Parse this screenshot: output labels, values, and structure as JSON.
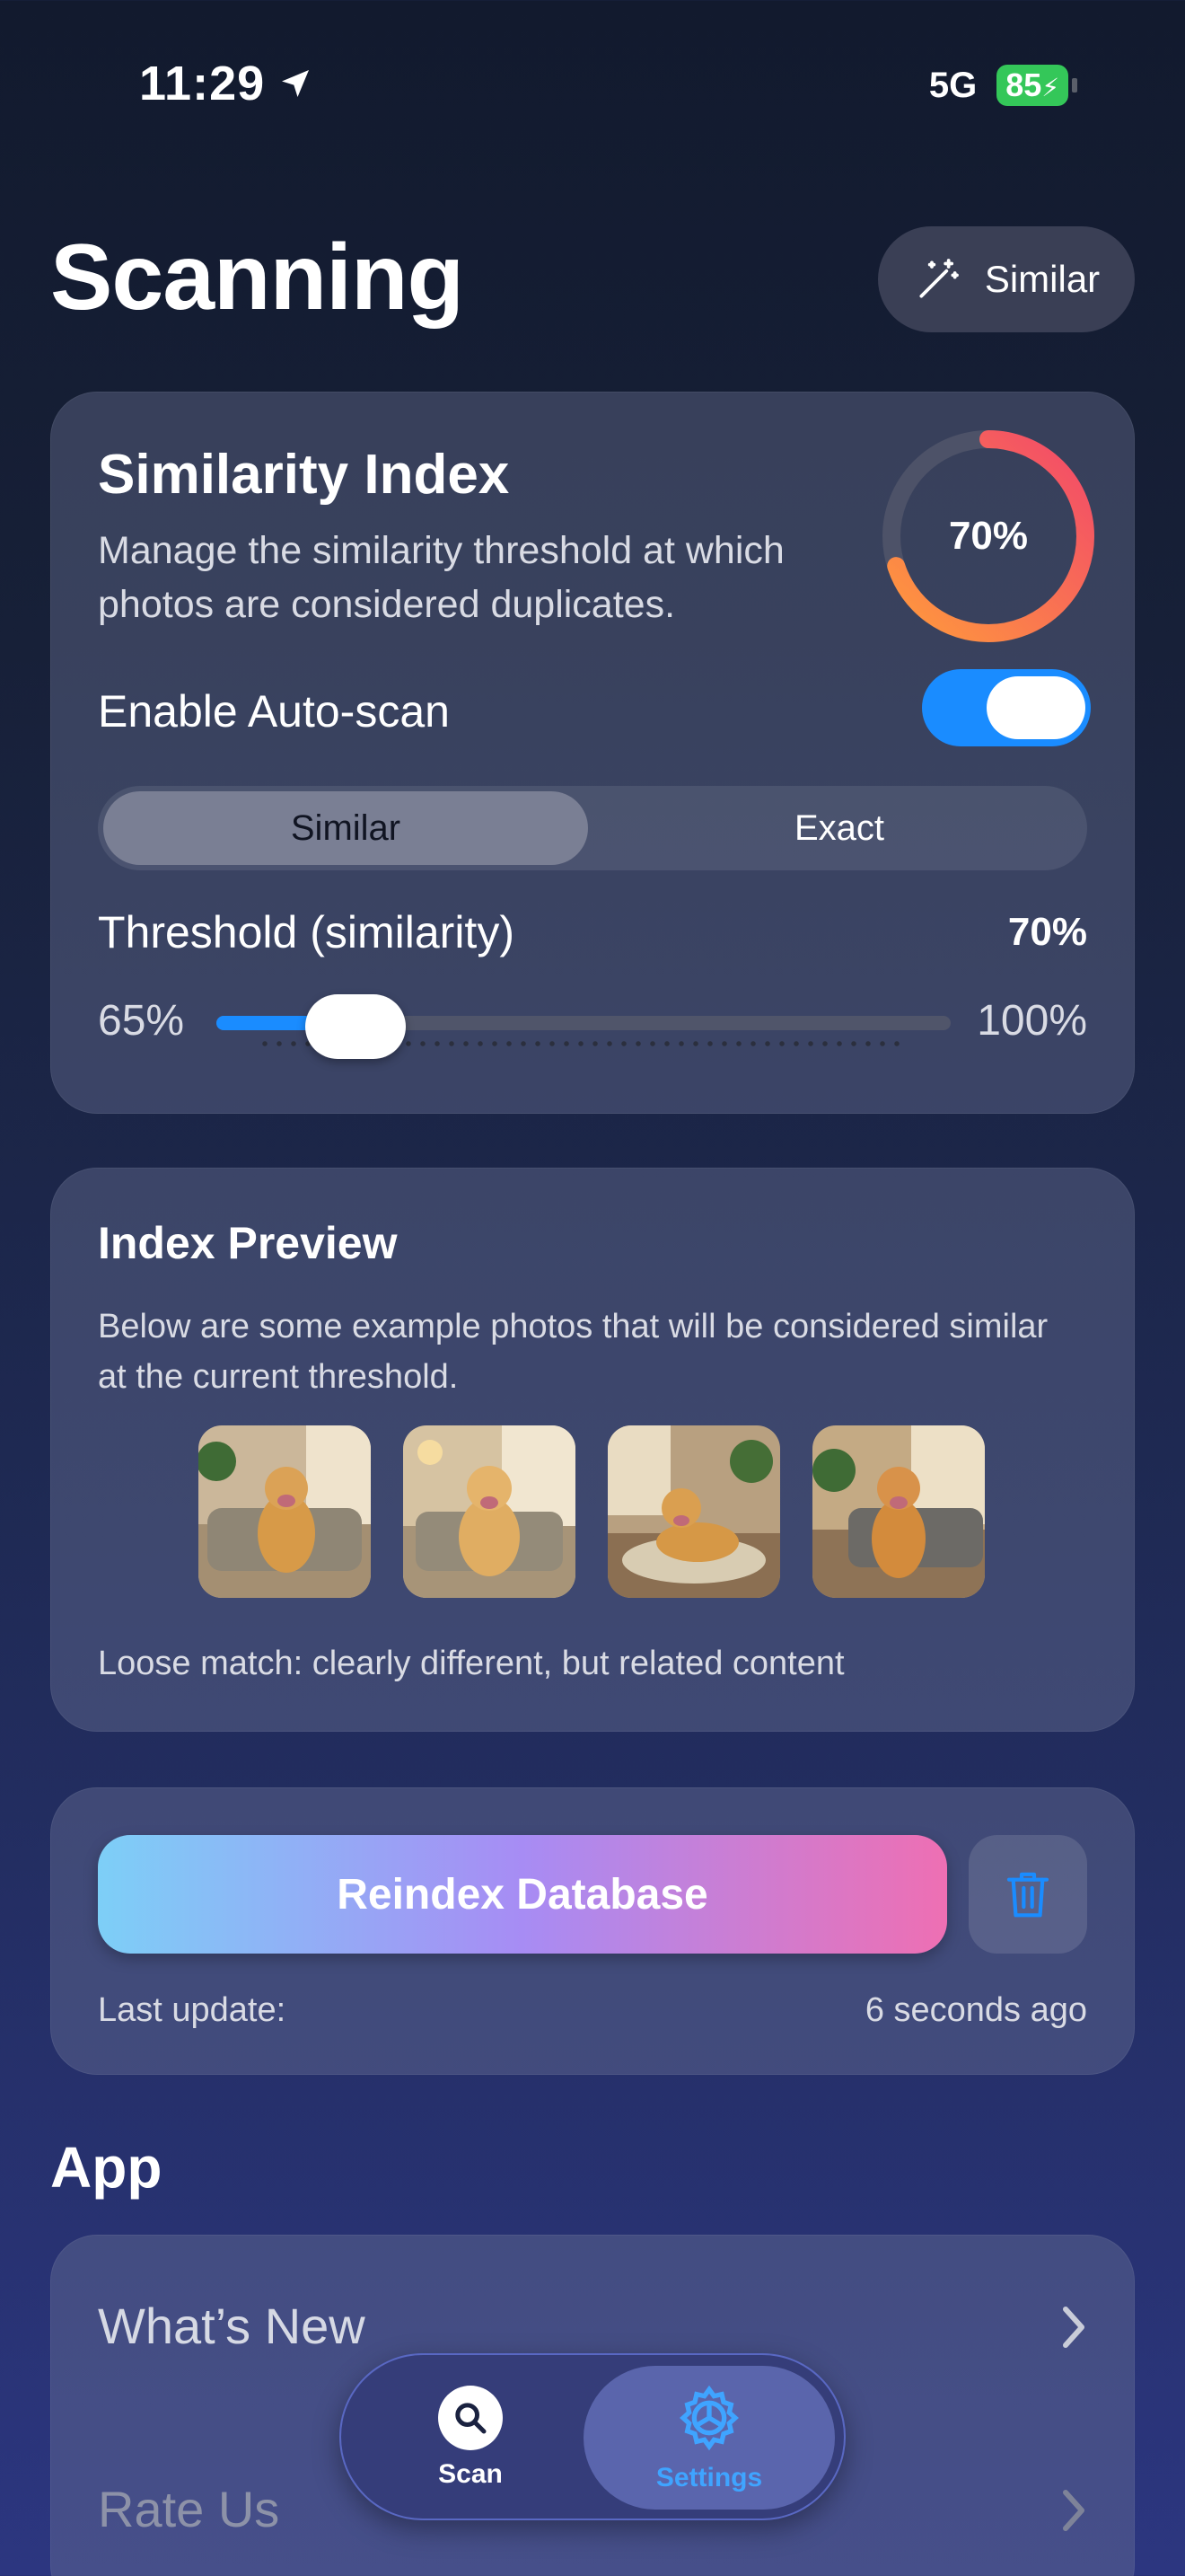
{
  "status_bar": {
    "time": "11:29",
    "network": "5G",
    "battery": "85"
  },
  "header": {
    "title": "Scanning",
    "mode_pill_label": "Similar"
  },
  "similarity_card": {
    "title": "Similarity Index",
    "description": "Manage the similarity threshold at which photos are considered duplicates.",
    "ring_percent": "70%",
    "ring_fraction": 0.7,
    "auto_scan_label": "Enable Auto-scan",
    "auto_scan_enabled": true,
    "segments": [
      "Similar",
      "Exact"
    ],
    "selected_segment": "Similar",
    "threshold_label": "Threshold (similarity)",
    "threshold_value": "70%",
    "slider_min": "65%",
    "slider_max": "100%",
    "slider_fraction": 0.19
  },
  "preview_card": {
    "title": "Index Preview",
    "description": "Below are some example photos that will be considered similar at the current threshold.",
    "photos": [
      "dog-on-sofa-1",
      "dog-on-sofa-2",
      "dog-on-rug",
      "dog-on-sofa-3"
    ],
    "note": "Loose match: clearly different, but related content"
  },
  "reindex_card": {
    "button_label": "Reindex Database",
    "last_update_label": "Last update:",
    "last_update_value": "6 seconds ago"
  },
  "app_section": {
    "title": "App",
    "rows": [
      {
        "label": "What’s New"
      },
      {
        "label": "Rate Us"
      }
    ]
  },
  "tab_bar": {
    "tabs": [
      {
        "label": "Scan",
        "icon": "search-icon"
      },
      {
        "label": "Settings",
        "icon": "gear-icon"
      }
    ],
    "active": "Settings"
  },
  "colors": {
    "accent": "#1a8cff",
    "battery": "#34c759",
    "ring_start": "#f2486a",
    "ring_end": "#ff9a3c"
  }
}
